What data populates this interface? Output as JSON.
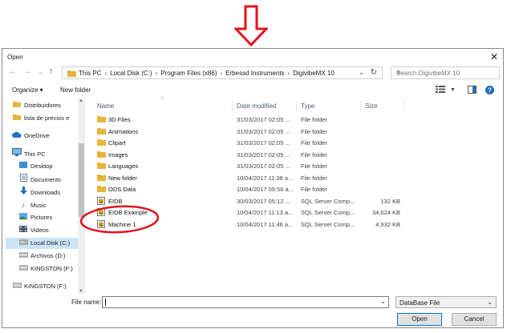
{
  "window": {
    "title": "Open",
    "close_glyph": "✕"
  },
  "nav_buttons": {
    "back_glyph": "←",
    "forward_glyph": "→",
    "history_glyph": "⌄",
    "up_glyph": "↑"
  },
  "address": {
    "crumbs": [
      "This PC",
      "Local Disk (C:)",
      "Program Files (x86)",
      "Erbessd Instruments",
      "DigivibeMX 10"
    ],
    "separator": "›",
    "dropdown_glyph": "⌄",
    "refresh_glyph": "↻"
  },
  "search": {
    "placeholder": "Search DigivibeMX 10",
    "icon_glyph": "⌕"
  },
  "toolbar": {
    "organize_label": "Organize ▾",
    "new_folder_label": "New folder"
  },
  "nav_pane": {
    "items": [
      {
        "label": "Distribuidores",
        "icon": "folder-icon"
      },
      {
        "label": "lista de precios e",
        "icon": "folder-icon"
      },
      {
        "label": "OneDrive",
        "icon": "cloud-icon"
      },
      {
        "label": "This PC",
        "icon": "computer-icon"
      },
      {
        "label": "Desktop",
        "icon": "desktop-icon"
      },
      {
        "label": "Documents",
        "icon": "documents-icon"
      },
      {
        "label": "Downloads",
        "icon": "downloads-icon"
      },
      {
        "label": "Music",
        "icon": "music-icon"
      },
      {
        "label": "Pictures",
        "icon": "pictures-icon"
      },
      {
        "label": "Videos",
        "icon": "videos-icon"
      },
      {
        "label": "Local Disk (C:)",
        "icon": "drive-icon",
        "selected": true
      },
      {
        "label": "Archivos (D:)",
        "icon": "drive-icon"
      },
      {
        "label": "KINGSTON (F:)",
        "icon": "usb-drive-icon"
      },
      {
        "label": "KINGSTON (F:)",
        "icon": "usb-drive-icon"
      }
    ]
  },
  "file_list": {
    "columns": {
      "name": "Name",
      "date": "Date modified",
      "type": "Type",
      "size": "Size"
    },
    "sort_glyph": "^",
    "rows": [
      {
        "name": "3D Files",
        "date": "31/03/2017 02:05 ...",
        "type": "File folder",
        "size": "",
        "icon": "folder-icon"
      },
      {
        "name": "Animations",
        "date": "31/03/2017 02:05 ...",
        "type": "File folder",
        "size": "",
        "icon": "folder-icon"
      },
      {
        "name": "Clipart",
        "date": "31/03/2017 02:05 ...",
        "type": "File folder",
        "size": "",
        "icon": "folder-icon"
      },
      {
        "name": "Images",
        "date": "31/03/2017 02:05 ...",
        "type": "File folder",
        "size": "",
        "icon": "folder-icon"
      },
      {
        "name": "Languages",
        "date": "31/03/2017 02:05 ...",
        "type": "File folder",
        "size": "",
        "icon": "folder-icon"
      },
      {
        "name": "New folder",
        "date": "10/04/2017 11:38 a...",
        "type": "File folder",
        "size": "",
        "icon": "folder-icon"
      },
      {
        "name": "ODS Data",
        "date": "10/04/2017 09:56 a...",
        "type": "File folder",
        "size": "",
        "icon": "folder-icon"
      },
      {
        "name": "EIDB",
        "date": "30/03/2017 05:12 ...",
        "type": "SQL Server Comp...",
        "size": "132 KB",
        "icon": "database-file-icon"
      },
      {
        "name": "EIDB Example",
        "date": "10/04/2017 11:13 a...",
        "type": "SQL Server Comp...",
        "size": "34,624 KB",
        "icon": "database-file-icon"
      },
      {
        "name": "Machine 1",
        "date": "10/04/2017 11:46 a...",
        "type": "SQL Server Comp...",
        "size": "4,932 KB",
        "icon": "database-file-icon"
      }
    ]
  },
  "bottom": {
    "file_name_label": "File name:",
    "file_name_value": "",
    "file_type_value": "DataBase File",
    "dropdown_glyph": "⌄",
    "open_label": "Open",
    "cancel_label": "Cancel"
  },
  "colors": {
    "annotation": "#e0141e",
    "selection": "#cce4f7",
    "header_text": "#4c607a",
    "folder": "#e8b43a"
  }
}
